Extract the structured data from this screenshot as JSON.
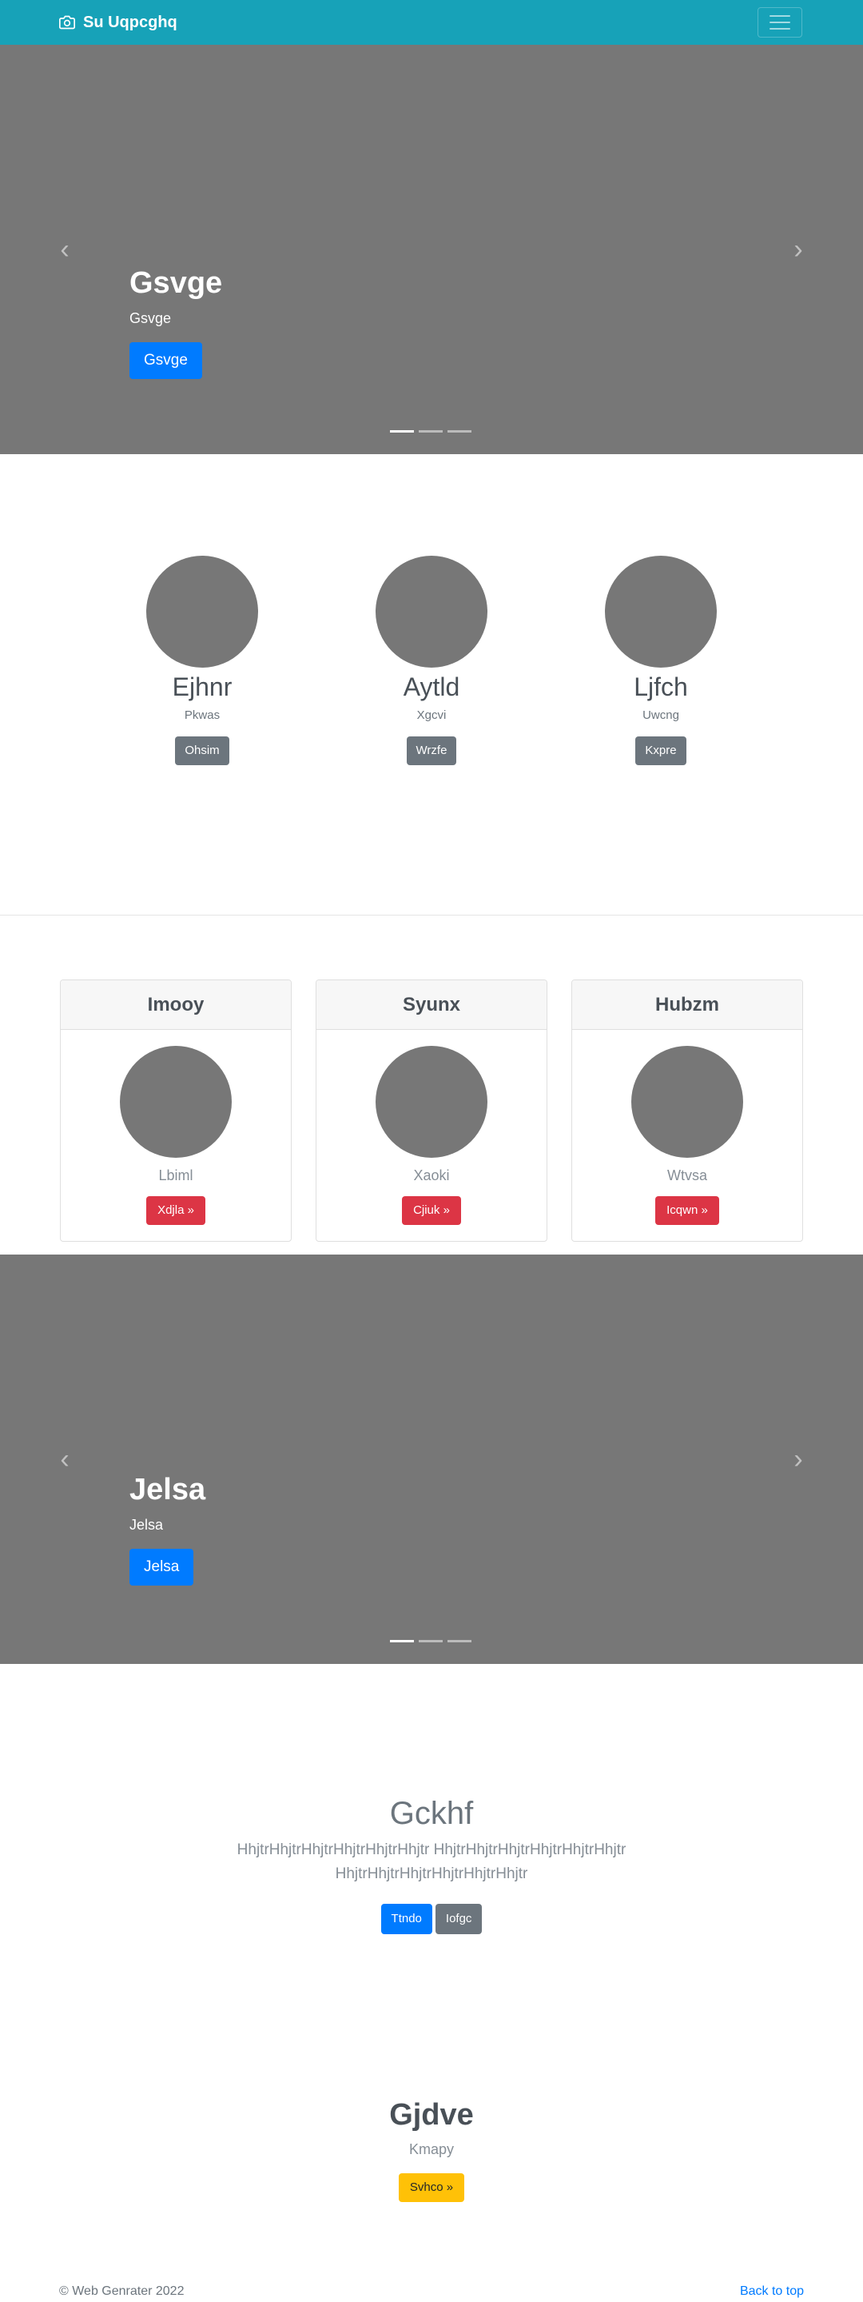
{
  "navbar": {
    "brand": "Su Uqpcghq",
    "brand_icon": "camera-icon",
    "toggle_icon": "hamburger-icon"
  },
  "carousel1": {
    "title": "Gsvge",
    "subtitle": "Gsvge",
    "button": "Gsvge",
    "prev": "‹",
    "next": "›",
    "slides": 3,
    "active_slide": 1
  },
  "people": [
    {
      "name": "Ejhnr",
      "role": "Pkwas",
      "button": "Ohsim"
    },
    {
      "name": "Aytld",
      "role": "Xgcvi",
      "button": "Wrzfe"
    },
    {
      "name": "Ljfch",
      "role": "Uwcng",
      "button": "Kxpre"
    }
  ],
  "cards": [
    {
      "header": "Imooy",
      "text": "Lbiml",
      "button": "Xdjla »"
    },
    {
      "header": "Syunx",
      "text": "Xaoki",
      "button": "Cjiuk »"
    },
    {
      "header": "Hubzm",
      "text": "Wtvsa",
      "button": "Icqwn »"
    }
  ],
  "carousel2": {
    "title": "Jelsa",
    "subtitle": "Jelsa",
    "button": "Jelsa",
    "prev": "‹",
    "next": "›",
    "slides": 3,
    "active_slide": 1
  },
  "jumbotron": {
    "title": "Gckhf",
    "lead": "HhjtrHhjtrHhjtrHhjtrHhjtrHhjtr HhjtrHhjtrHhjtrHhjtrHhjtrHhjtr HhjtrHhjtrHhjtrHhjtrHhjtrHhjtr",
    "primary_button": "Ttndo",
    "secondary_button": "Iofgc"
  },
  "feature": {
    "title": "Gjdve",
    "subtitle": "Kmapy",
    "button": "Svhco »"
  },
  "footer": {
    "copyright": "© Web Genrater 2022",
    "back_to_top": "Back to top"
  },
  "colors": {
    "navbar": "#17a2b8",
    "placeholder_gray": "#777777",
    "primary": "#007bff",
    "secondary": "#6c757d",
    "danger": "#dc3545",
    "warning": "#ffc107"
  }
}
